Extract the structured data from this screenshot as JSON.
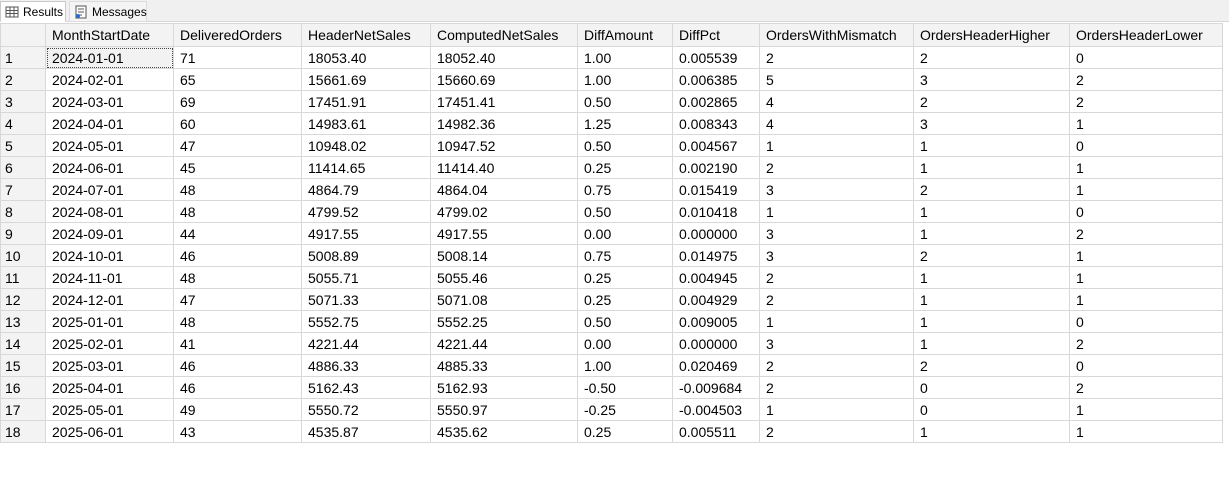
{
  "tabs": [
    {
      "label": "Results",
      "icon": "grid-icon",
      "active": true
    },
    {
      "label": "Messages",
      "icon": "messages-icon",
      "active": false
    }
  ],
  "columns": [
    "MonthStartDate",
    "DeliveredOrders",
    "HeaderNetSales",
    "ComputedNetSales",
    "DiffAmount",
    "DiffPct",
    "OrdersWithMismatch",
    "OrdersHeaderHigher",
    "OrdersHeaderLower"
  ],
  "rows": [
    [
      "1",
      "2024-01-01",
      "71",
      "18053.40",
      "18052.40",
      "1.00",
      "0.005539",
      "2",
      "2",
      "0"
    ],
    [
      "2",
      "2024-02-01",
      "65",
      "15661.69",
      "15660.69",
      "1.00",
      "0.006385",
      "5",
      "3",
      "2"
    ],
    [
      "3",
      "2024-03-01",
      "69",
      "17451.91",
      "17451.41",
      "0.50",
      "0.002865",
      "4",
      "2",
      "2"
    ],
    [
      "4",
      "2024-04-01",
      "60",
      "14983.61",
      "14982.36",
      "1.25",
      "0.008343",
      "4",
      "3",
      "1"
    ],
    [
      "5",
      "2024-05-01",
      "47",
      "10948.02",
      "10947.52",
      "0.50",
      "0.004567",
      "1",
      "1",
      "0"
    ],
    [
      "6",
      "2024-06-01",
      "45",
      "11414.65",
      "11414.40",
      "0.25",
      "0.002190",
      "2",
      "1",
      "1"
    ],
    [
      "7",
      "2024-07-01",
      "48",
      "4864.79",
      "4864.04",
      "0.75",
      "0.015419",
      "3",
      "2",
      "1"
    ],
    [
      "8",
      "2024-08-01",
      "48",
      "4799.52",
      "4799.02",
      "0.50",
      "0.010418",
      "1",
      "1",
      "0"
    ],
    [
      "9",
      "2024-09-01",
      "44",
      "4917.55",
      "4917.55",
      "0.00",
      "0.000000",
      "3",
      "1",
      "2"
    ],
    [
      "10",
      "2024-10-01",
      "46",
      "5008.89",
      "5008.14",
      "0.75",
      "0.014975",
      "3",
      "2",
      "1"
    ],
    [
      "11",
      "2024-11-01",
      "48",
      "5055.71",
      "5055.46",
      "0.25",
      "0.004945",
      "2",
      "1",
      "1"
    ],
    [
      "12",
      "2024-12-01",
      "47",
      "5071.33",
      "5071.08",
      "0.25",
      "0.004929",
      "2",
      "1",
      "1"
    ],
    [
      "13",
      "2025-01-01",
      "48",
      "5552.75",
      "5552.25",
      "0.50",
      "0.009005",
      "1",
      "1",
      "0"
    ],
    [
      "14",
      "2025-02-01",
      "41",
      "4221.44",
      "4221.44",
      "0.00",
      "0.000000",
      "3",
      "1",
      "2"
    ],
    [
      "15",
      "2025-03-01",
      "46",
      "4886.33",
      "4885.33",
      "1.00",
      "0.020469",
      "2",
      "2",
      "0"
    ],
    [
      "16",
      "2025-04-01",
      "46",
      "5162.43",
      "5162.93",
      "-0.50",
      "-0.009684",
      "2",
      "0",
      "2"
    ],
    [
      "17",
      "2025-05-01",
      "49",
      "5550.72",
      "5550.97",
      "-0.25",
      "-0.004503",
      "1",
      "0",
      "1"
    ],
    [
      "18",
      "2025-06-01",
      "43",
      "4535.87",
      "4535.62",
      "0.25",
      "0.005511",
      "2",
      "1",
      "1"
    ]
  ]
}
